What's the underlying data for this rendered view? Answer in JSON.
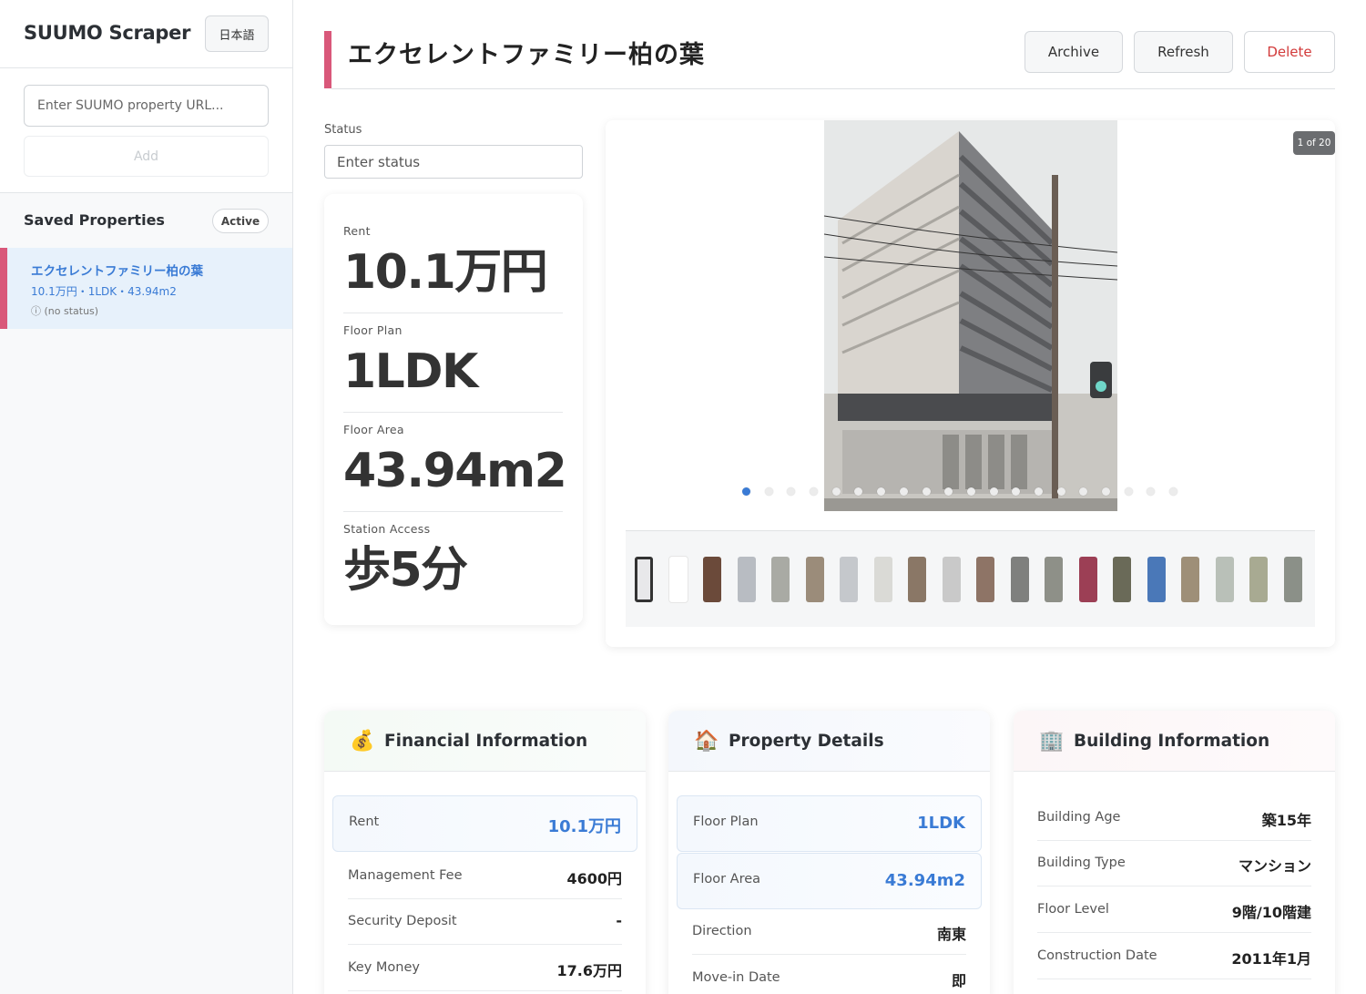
{
  "sidebar": {
    "app_title": "SUUMO Scraper",
    "lang_button": "日本語",
    "url_placeholder": "Enter SUUMO property URL...",
    "add_label": "Add",
    "saved_heading": "Saved Properties",
    "filter_badge": "Active",
    "items": [
      {
        "title": "エクセレントファミリー柏の葉",
        "summary": "10.1万円・1LDK・43.94m2",
        "status": "ⓘ  (no status)"
      }
    ]
  },
  "header": {
    "title": "エクセレントファミリー柏の葉",
    "archive_label": "Archive",
    "refresh_label": "Refresh",
    "delete_label": "Delete"
  },
  "status": {
    "label": "Status",
    "placeholder": "Enter status"
  },
  "stats": [
    {
      "label": "Rent",
      "value": "10.1万円"
    },
    {
      "label": "Floor Plan",
      "value": "1LDK"
    },
    {
      "label": "Floor Area",
      "value": "43.94m2"
    },
    {
      "label": "Station Access",
      "value": "歩5分"
    }
  ],
  "gallery": {
    "counter": "1 of 20",
    "total": 20,
    "current": 1,
    "thumb_colors": [
      "#e8e8ea",
      "#ffffff",
      "#6b4a3a",
      "#b8bcc2",
      "#a9aaa4",
      "#9b8c7a",
      "#c5c8cc",
      "#dadad6",
      "#8a7766",
      "#c9c9c9",
      "#8e7466",
      "#7f807e",
      "#8e9088",
      "#9c3f55",
      "#6a6a58",
      "#4a78b8",
      "#9e8f78",
      "#b9c0b8",
      "#a8aa92",
      "#8b9088"
    ]
  },
  "financial": {
    "icon": "money-bag-icon",
    "title": "Financial Information",
    "rows": [
      {
        "key": "Rent",
        "value": "10.1万円"
      },
      {
        "key": "Management Fee",
        "value": "4600円"
      },
      {
        "key": "Security Deposit",
        "value": "-"
      },
      {
        "key": "Key Money",
        "value": "17.6万円"
      }
    ]
  },
  "property": {
    "icon": "house-icon",
    "title": "Property Details",
    "rows": [
      {
        "key": "Floor Plan",
        "value": "1LDK"
      },
      {
        "key": "Floor Area",
        "value": "43.94m2"
      },
      {
        "key": "Direction",
        "value": "南東"
      },
      {
        "key": "Move-in Date",
        "value": "即"
      }
    ]
  },
  "building": {
    "icon": "office-building-icon",
    "title": "Building Information",
    "rows": [
      {
        "key": "Building Age",
        "value": "築15年"
      },
      {
        "key": "Building Type",
        "value": "マンション"
      },
      {
        "key": "Floor Level",
        "value": "9階/10階建"
      },
      {
        "key": "Construction Date",
        "value": "2011年1月"
      }
    ]
  },
  "colors": {
    "accent": "#d9587a",
    "link": "#3a7bd5",
    "danger": "#d23a3a"
  }
}
